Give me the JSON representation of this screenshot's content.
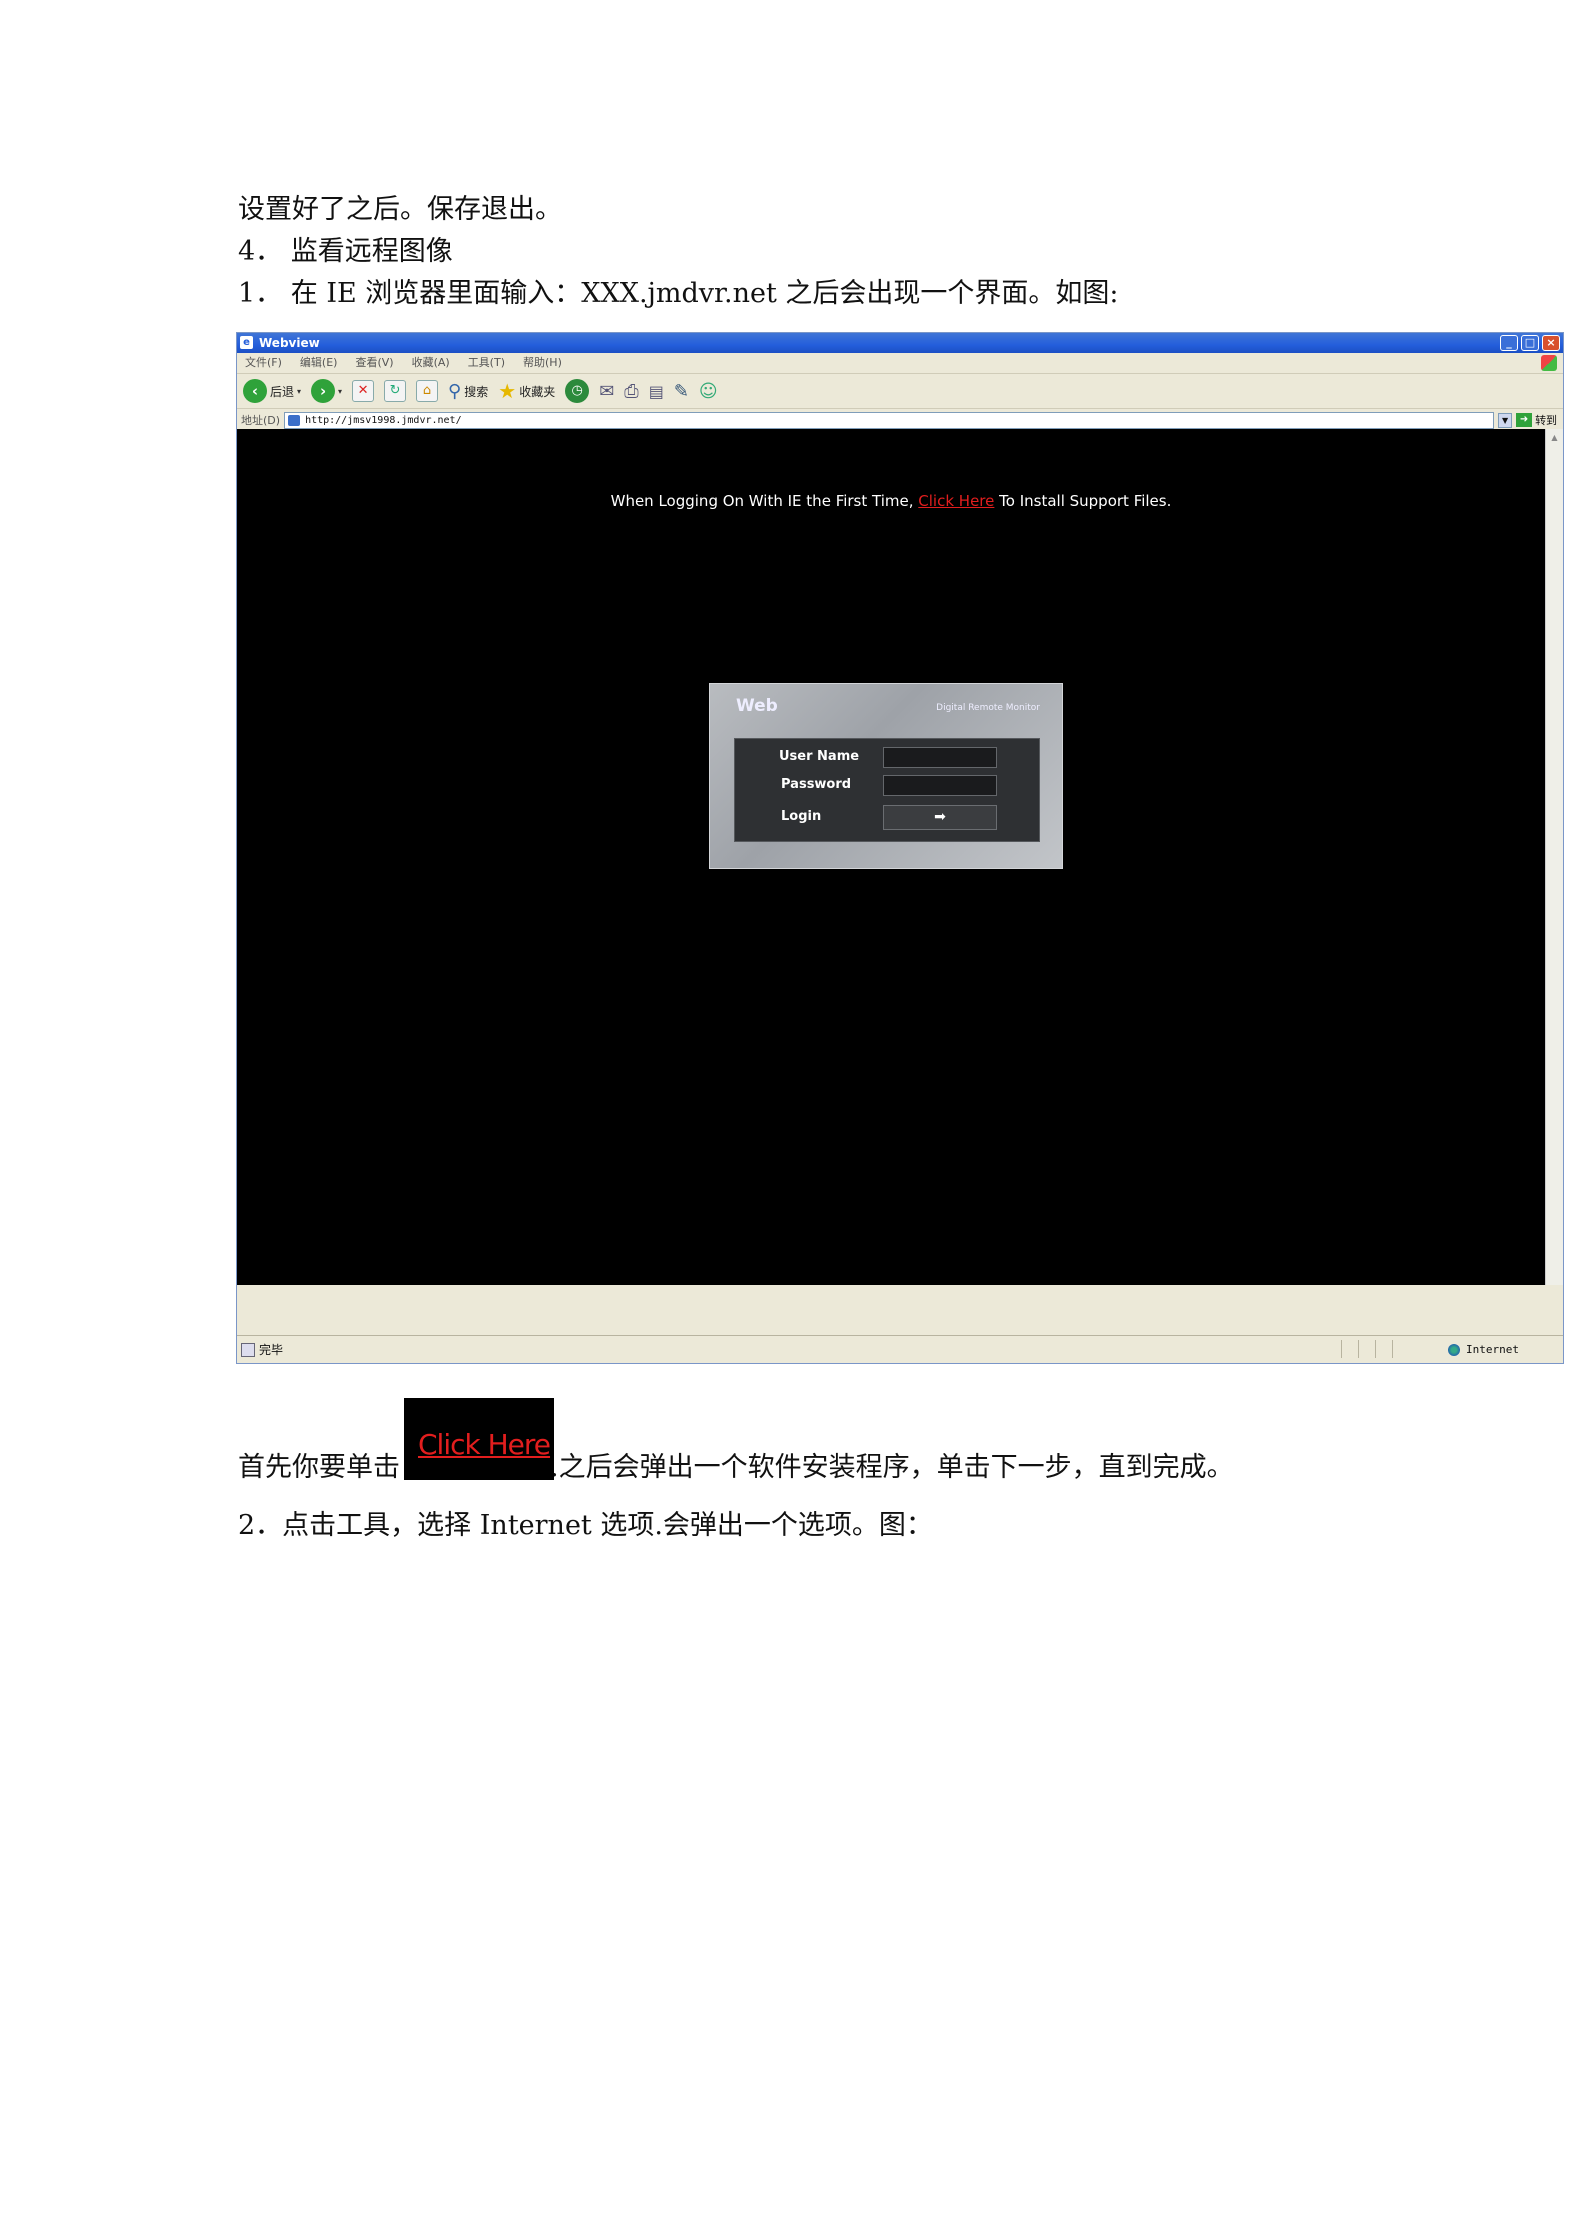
{
  "doc": {
    "line1": "设置好了之后。保存退出。",
    "line2": "4．  监看远程图像",
    "line3": "1．  在 IE 浏览器里面输入：XXX.jmdvr.net 之后会出现一个界面。如图:",
    "line4_before": "首先你要单击",
    "line4_after": ".之后会弹出一个软件安装程序，单击下一步，直到完成。",
    "line5": "2．点击工具，选择 Internet 选项.会弹出一个选项。图："
  },
  "browser": {
    "title": "Webview",
    "menu": [
      "文件(F)",
      "编辑(E)",
      "查看(V)",
      "收藏(A)",
      "工具(T)",
      "帮助(H)"
    ],
    "toolbar": {
      "back": "后退",
      "search": "搜索",
      "favorites": "收藏夹"
    },
    "address_label": "地址(D)",
    "address": "http://jmsv1998.jmdvr.net/",
    "go": "转到",
    "status": "完毕",
    "zone": "Internet"
  },
  "page": {
    "notice_before": "When Logging On With  IE  the First Time,  ",
    "notice_link": "Click Here",
    "notice_after": " To Install Support Files."
  },
  "login": {
    "brand": "Web",
    "subtitle": "Digital Remote Monitor",
    "username_label": "User Name",
    "password_label": "Password",
    "login_label": "Login"
  },
  "chip_text": "Click Here",
  "colors": {
    "link": "#e21e1e",
    "viewport": "#000000",
    "titlebar": "#245edb"
  }
}
